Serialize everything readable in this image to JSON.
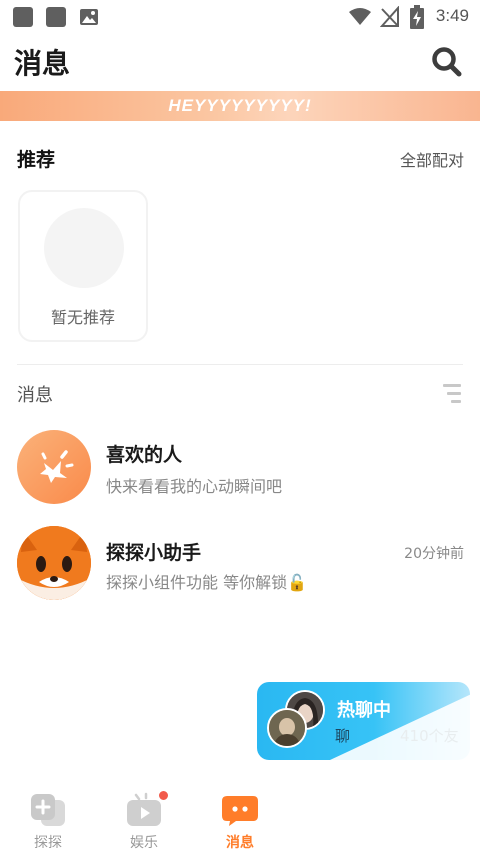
{
  "status_bar": {
    "time": "3:49"
  },
  "header": {
    "title": "消息"
  },
  "banner": {
    "text": "HEYYYYYYYYY!"
  },
  "recommend": {
    "title": "推荐",
    "all_match": "全部配对",
    "empty_text": "暂无推荐"
  },
  "messages": {
    "title": "消息",
    "items": [
      {
        "name": "喜欢的人",
        "preview": "快来看看我的心动瞬间吧",
        "time": ""
      },
      {
        "name": "探探小助手",
        "preview": "探探小组件功能 等你解锁🔓",
        "time": "20分钟前"
      }
    ]
  },
  "hot_chat": {
    "title": "热聊中",
    "sub": "聊",
    "count": "410个友"
  },
  "tabs": [
    {
      "label": "探探",
      "active": false
    },
    {
      "label": "娱乐",
      "active": false,
      "badge": true
    },
    {
      "label": "消息",
      "active": true
    }
  ],
  "colors": {
    "accent": "#ff7d2a",
    "hot_blue": "#2ab8f2",
    "badge": "#f25a4b"
  }
}
